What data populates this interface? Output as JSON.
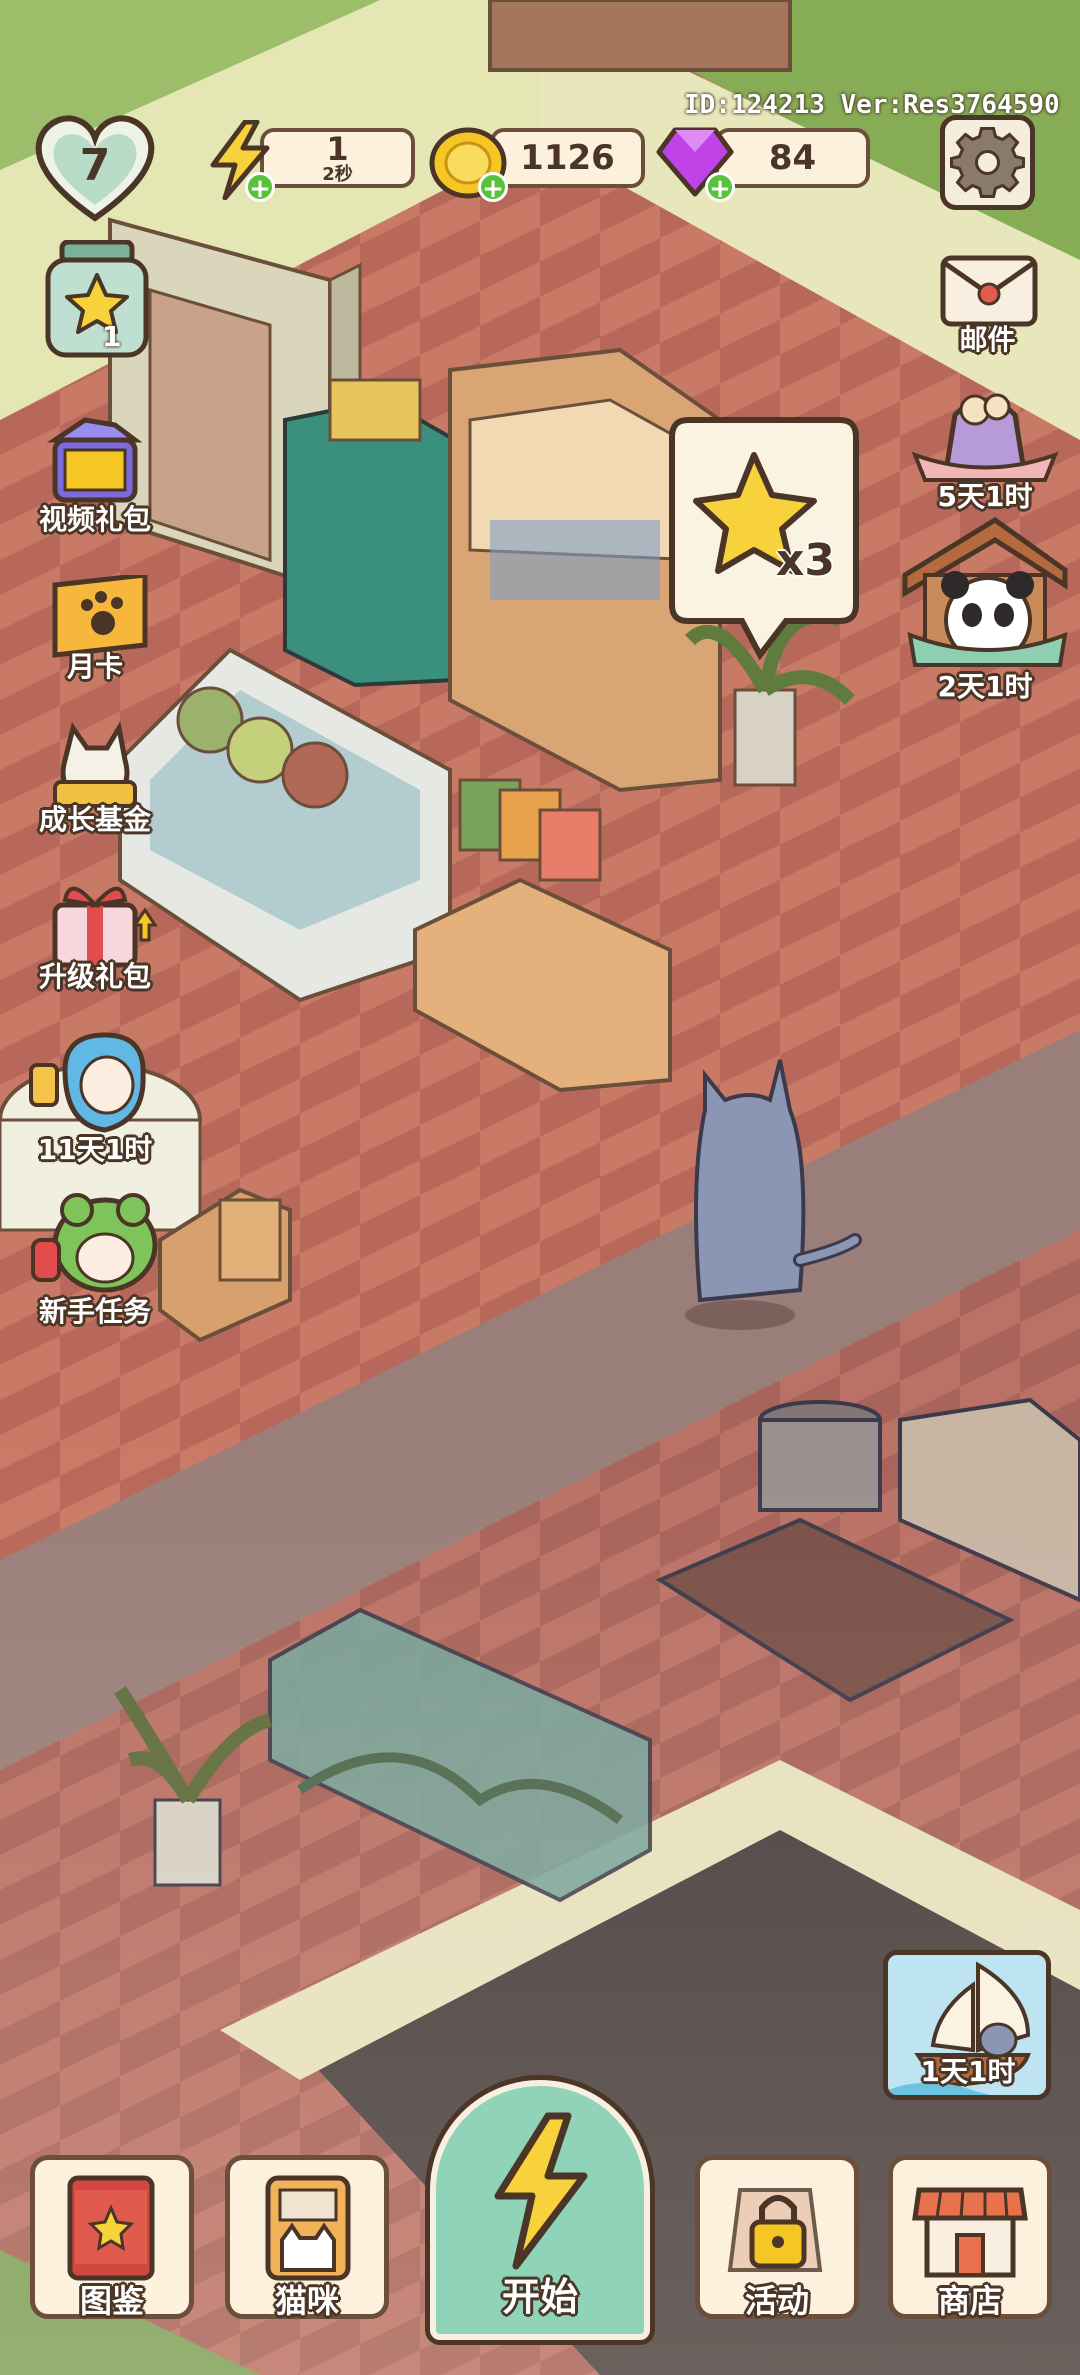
{
  "hud": {
    "level": "7",
    "energy": "1",
    "energy_timer": "2秒",
    "coins": "1126",
    "gems": "84",
    "account_info": "ID:124213 Ver:Res3764590"
  },
  "left_menu": {
    "star_count": "1",
    "video_gift": "视频礼包",
    "monthly_card": "月卡",
    "growth_fund": "成长基金",
    "upgrade_gift": "升级礼包",
    "event_timer": "11天1时",
    "newbie_tasks": "新手任务"
  },
  "right_menu": {
    "mail": "邮件",
    "cookie_timer": "5天1时",
    "panda_timer": "2天1时",
    "boat_timer": "1天1时"
  },
  "star_bubble": {
    "multiplier": "x3"
  },
  "bottom_nav": {
    "encyclopedia": "图鉴",
    "cats": "猫咪",
    "start": "开始",
    "activity": "活动",
    "shop": "商店"
  },
  "colors": {
    "outline": "#4a3526",
    "panel": "#fbf1dc",
    "green_plus": "#58c23d",
    "start_button": "#8fd3b8",
    "gem_purple": "#c043e8",
    "coin_gold": "#f6c624"
  }
}
